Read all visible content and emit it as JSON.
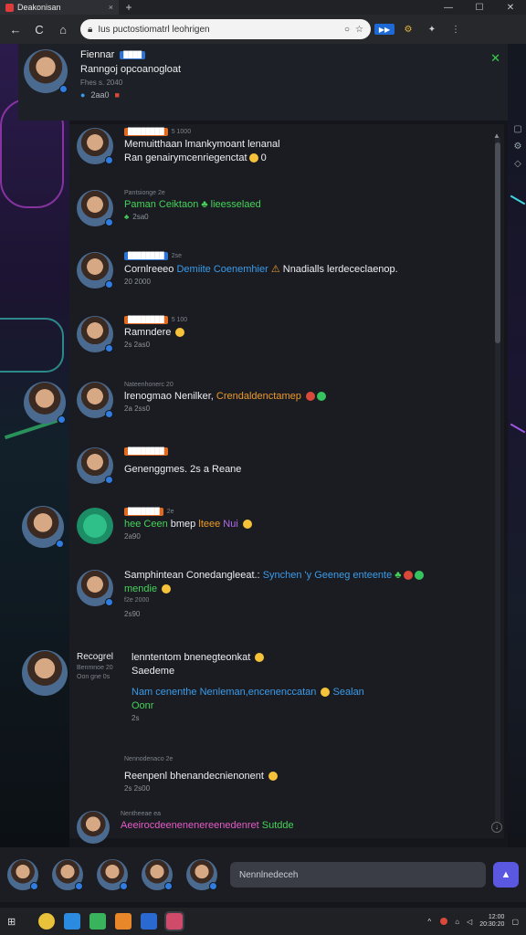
{
  "browser": {
    "tab_title": "Deakonisan",
    "tab_close": "×",
    "new_tab": "+",
    "window_controls": [
      "—",
      "☐",
      "✕"
    ],
    "nav": {
      "back": "←",
      "reload": "C",
      "home": "⌂"
    },
    "address": "Ius puctostiomatrl leohrigen",
    "extensions": [
      "⚙",
      "✦",
      "⋮"
    ],
    "ext_badge": "▶▶"
  },
  "header": {
    "name": "Fiennar",
    "badge": "████",
    "subtitle": "Ranngoj opcoanogloat",
    "meta": "Fhes s. 2040",
    "stats": "2aa0",
    "close_icon": "✕"
  },
  "messages": [
    {
      "meta_badge": "████████",
      "meta": "5 1000",
      "lines": [
        "Memuitthaan lmankymoant lenanal",
        "Ran genairymcenriegenctat"
      ],
      "react": "0"
    },
    {
      "meta": "Pantsionge 2e",
      "lines": [
        "Paman Ceiktaon",
        "lieesselaed"
      ],
      "react": "2sa0"
    },
    {
      "meta_badge": "████████",
      "meta": "2se",
      "lines": [
        "Cornlreeeo",
        "Demiite Coenemhier",
        "Nnadialls lerdececlaenop."
      ],
      "react": "20 2000"
    },
    {
      "meta_badge": "████████",
      "meta": "5 100",
      "lines": [
        "Ramndere"
      ],
      "react": "2s 2as0"
    },
    {
      "meta": "Nateenhonerc 20",
      "lines": [
        "lrenogmao Nenilker,",
        "Crendaldenctamep"
      ],
      "react": "2a 2ss0"
    },
    {
      "meta_badge": "████████",
      "lines": [
        "Genenggmes. 2s a Reane"
      ]
    },
    {
      "meta_badge": "███████",
      "meta": "2e",
      "lines": [
        "hee Ceen",
        "bmep",
        "lteee",
        "Nui"
      ],
      "react": "2a90"
    },
    {
      "lines": [
        "Samphintean Conedangleeat.:",
        "Synchen 'y Geeneg enteente",
        "mendie"
      ],
      "meta2": "f2e 2000",
      "react": "2s90"
    },
    {
      "name": "Recogrel",
      "meta": "Benmnoe 20",
      "submeta": "Oon gne 0s",
      "lines": [
        "lenntentom bnenegteonkat",
        "Saedeme",
        "Nam cenenthe Nenleman,encenenccatan",
        "Sealan",
        "Oonr"
      ],
      "react": "2s"
    },
    {
      "meta": "Nennodenaco 2e",
      "lines": [
        "Reenpenl bhenandecnienonent"
      ],
      "react": "2s 2s00"
    },
    {
      "meta": "Nentheeae ea",
      "lines": [
        "Aeeirocdeenenenereenedenret",
        "Sutdde"
      ]
    }
  ],
  "composer": {
    "placeholder": "Nennlnedeceh",
    "send_icon": "▲"
  },
  "taskbar": {
    "start_icon": "⊞",
    "clock_time": "12:00",
    "clock_date": "20:30:20",
    "tray": "^"
  },
  "colors": {
    "accent_green": "#45d35a",
    "accent_blue": "#3b9bea",
    "accent_orange": "#ec9a2a",
    "send_purple": "#5a58e0"
  }
}
